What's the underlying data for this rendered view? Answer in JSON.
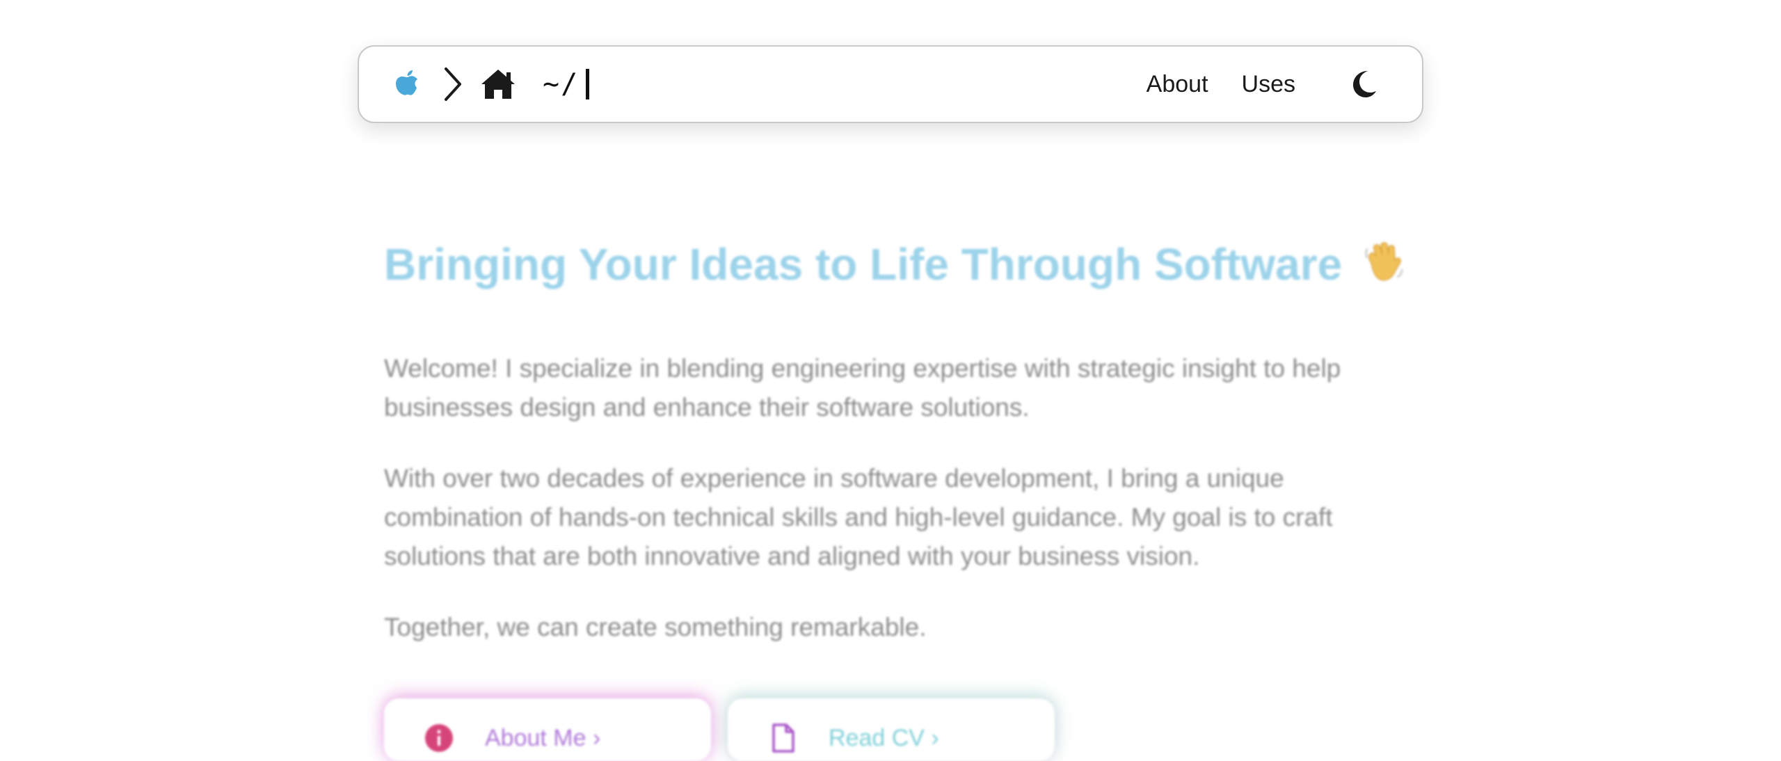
{
  "navbar": {
    "path": "~/",
    "links": [
      {
        "label": "About"
      },
      {
        "label": "Uses"
      }
    ],
    "icons": {
      "logo": "apple-icon",
      "separator": "chevron-right-icon",
      "home": "home-icon",
      "theme_toggle": "moon-icon"
    },
    "colors": {
      "apple": "#4aa8d8",
      "text": "#1a1a1a",
      "border": "#c9c9c9"
    }
  },
  "hero": {
    "title": "Bringing Your Ideas to Life Through Software",
    "title_emoji": "waving-hand-icon",
    "title_color": "#9cd3ea",
    "paragraphs": [
      "Welcome! I specialize in blending engineering expertise with strategic insight to help businesses design and enhance their software solutions.",
      "With over two decades of experience in software development, I bring a unique combination of hands-on technical skills and high-level guidance. My goal is to craft solutions that are both innovative and aligned with your business vision.",
      "Together, we can create something remarkable."
    ],
    "text_color": "#8c8c8c"
  },
  "cards": [
    {
      "label": "About Me  ›",
      "icon": "info-icon",
      "color": "#b07ad8"
    },
    {
      "label": "Read CV  ›",
      "icon": "document-icon",
      "color": "#7fd0d8"
    }
  ]
}
